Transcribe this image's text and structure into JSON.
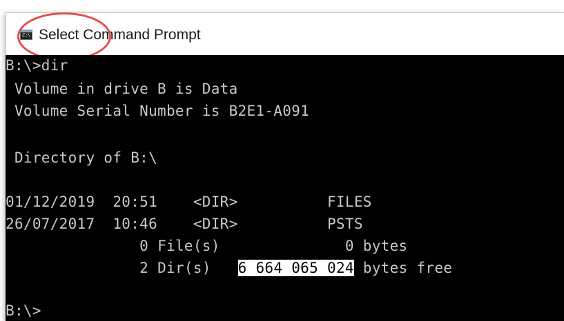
{
  "window": {
    "title": "Select Command Prompt",
    "icon": "command-prompt-icon",
    "icon_glyph": "C:\\"
  },
  "annotation": {
    "color": "#e84b4b",
    "shape": "circle"
  },
  "console": {
    "colors": {
      "background": "#000000",
      "text": "#c8c8c8",
      "selection_bg": "#ffffff",
      "selection_fg": "#000000"
    },
    "command_line": "B:\\>dir",
    "volume_line": " Volume in drive B is Data",
    "serial_line": " Volume Serial Number is B2E1-A091",
    "directory_line": " Directory of B:\\",
    "entries": [
      {
        "date": "01/12/2019",
        "time": "20:51",
        "type": "<DIR>",
        "name": "FILES"
      },
      {
        "date": "26/07/2017",
        "time": "10:46",
        "type": "<DIR>",
        "name": "PSTS"
      }
    ],
    "files_summary": {
      "count": "0",
      "label": "File(s)",
      "size": "0",
      "unit": "bytes"
    },
    "dirs_summary": {
      "count": "2",
      "label": "Dir(s)",
      "free_bytes": "6 664 065 024",
      "unit": "bytes free"
    },
    "prompt": "B:\\>"
  }
}
